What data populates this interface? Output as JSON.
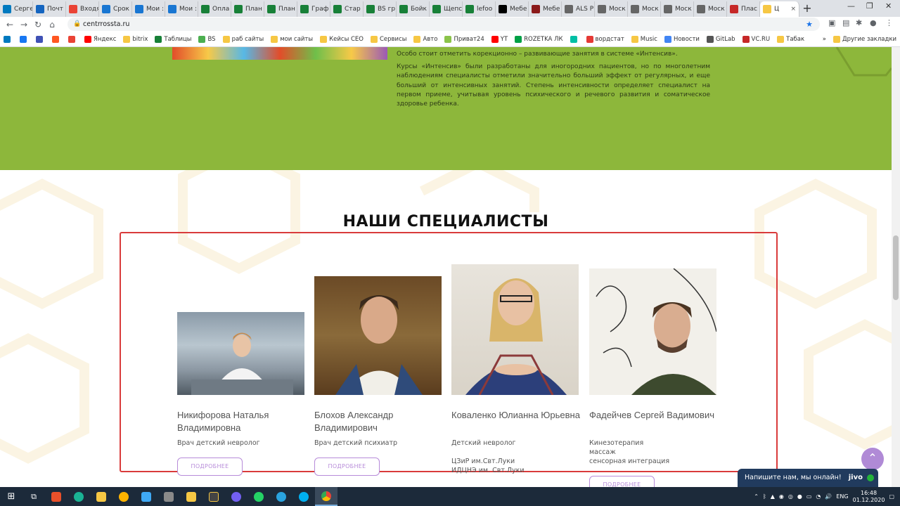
{
  "browser": {
    "tabs": [
      {
        "label": "Серге",
        "icon": "trello-icon",
        "color": "#0079bf"
      },
      {
        "label": "Почт",
        "icon": "mail-icon",
        "color": "#1565c0"
      },
      {
        "label": "Входя",
        "icon": "gmail-icon",
        "color": "#ea4335"
      },
      {
        "label": "Срок",
        "icon": "24-icon",
        "color": "#1976d2"
      },
      {
        "label": "Мои :",
        "icon": "24-icon",
        "color": "#1976d2"
      },
      {
        "label": "Мои :",
        "icon": "24-icon",
        "color": "#1976d2"
      },
      {
        "label": "Опла",
        "icon": "sheets-icon",
        "color": "#188038"
      },
      {
        "label": "План",
        "icon": "sheets-icon",
        "color": "#188038"
      },
      {
        "label": "План",
        "icon": "sheets-icon",
        "color": "#188038"
      },
      {
        "label": "Граф",
        "icon": "sheets-icon",
        "color": "#188038"
      },
      {
        "label": "Стар",
        "icon": "sheets-icon",
        "color": "#188038"
      },
      {
        "label": "BS гр",
        "icon": "sheets-icon",
        "color": "#188038"
      },
      {
        "label": "Бойк",
        "icon": "sheets-icon",
        "color": "#188038"
      },
      {
        "label": "Щепс",
        "icon": "sheets-icon",
        "color": "#188038"
      },
      {
        "label": "lefoo",
        "icon": "sheets-icon",
        "color": "#188038"
      },
      {
        "label": "Мебе",
        "icon": "site-icon",
        "color": "#000000"
      },
      {
        "label": "Мебе",
        "icon": "site-icon",
        "color": "#8b1a1a"
      },
      {
        "label": "ALS P",
        "icon": "globe-icon",
        "color": "#666666"
      },
      {
        "label": "Моск",
        "icon": "globe-icon",
        "color": "#666666"
      },
      {
        "label": "Моск",
        "icon": "globe-icon",
        "color": "#666666"
      },
      {
        "label": "Моск",
        "icon": "globe-icon",
        "color": "#666666"
      },
      {
        "label": "Моск",
        "icon": "globe-icon",
        "color": "#666666"
      },
      {
        "label": "Плас",
        "icon": "site-icon",
        "color": "#c62828"
      }
    ],
    "active_tab": {
      "label": "Ц",
      "icon": "site-icon"
    },
    "new_tab": "+",
    "url": "centrrossta.ru",
    "bookmarks_more": "»",
    "other_bookmarks": "Другие закладки",
    "bookmarks": [
      {
        "label": "",
        "color": "#0079bf"
      },
      {
        "label": "",
        "color": "#1877f2"
      },
      {
        "label": "",
        "color": "#3f51b5"
      },
      {
        "label": "",
        "color": "#ff5722"
      },
      {
        "label": "",
        "color": "#ea4335"
      },
      {
        "label": "Яндекс",
        "color": "#ff0000"
      },
      {
        "label": "bitrix",
        "color": "#f6c744"
      },
      {
        "label": "Таблицы",
        "color": "#188038"
      },
      {
        "label": "BS",
        "color": "#4caf50"
      },
      {
        "label": "раб сайты",
        "color": "#f6c744"
      },
      {
        "label": "мои сайты",
        "color": "#f6c744"
      },
      {
        "label": "Кейсы СЕО",
        "color": "#f6c744"
      },
      {
        "label": "Сервисы",
        "color": "#f6c744"
      },
      {
        "label": "Авто",
        "color": "#f6c744"
      },
      {
        "label": "Приват24",
        "color": "#8bc34a"
      },
      {
        "label": "YT",
        "color": "#ff0000"
      },
      {
        "label": "ROZETKA ЛК",
        "color": "#00a046"
      },
      {
        "label": "",
        "color": "#00bfa5"
      },
      {
        "label": "вордстат",
        "color": "#e53935"
      },
      {
        "label": "Music",
        "color": "#f6c744"
      },
      {
        "label": "Новости",
        "color": "#4285f4"
      },
      {
        "label": "GitLab",
        "color": "#555555"
      },
      {
        "label": "VC.RU",
        "color": "#c62828"
      },
      {
        "label": "Табак",
        "color": "#f6c744"
      }
    ]
  },
  "content": {
    "intro_paragraphs": [
      "Особо стоит отметить корекционно – развивающие занятия в системе «Интенсив».",
      "Курсы «Интенсив» были разработаны для иногородних пациентов, но по многолетним наблюдениям специалисты отметили значительно больший эффект от регулярных, и еще больший от интенсивных занятий. Степень интенсивности определяет специалист на первом приеме, учитывая уровень психического и речевого развития и соматическое здоровье ребенка."
    ],
    "section_title": "НАШИ СПЕЦИАЛИСТЫ",
    "specialists": [
      {
        "name": "Никифорова Наталья Владимировна",
        "role": "Врач детский невролог",
        "button": "ПОДРОБНЕЕ"
      },
      {
        "name": "Блохов Александр Владимирович",
        "role": "Врач детский психиатр",
        "button": "ПОДРОБНЕЕ"
      },
      {
        "name": "Коваленко Юлианна Юрьевна",
        "role": "Детский невролог",
        "extra": "ЦЗиР им.Свт.Луки\nИДЦНЭ им. Свт.Луки",
        "button": ""
      },
      {
        "name": "Фадейчев Сергей Вадимович",
        "role": "Кинезотерапия\nмассаж\nсенсорная интеграция",
        "button": "ПОДРОБНЕЕ"
      }
    ],
    "scroll_up": "^",
    "chat_text": "Напишите нам, мы онлайн!",
    "chat_brand": "jivo"
  },
  "taskbar": {
    "lang": "ENG",
    "time": "16:48",
    "date": "01.12.2020"
  },
  "colors": {
    "green_band": "#8db73b",
    "highlight_box": "#d93b3b",
    "button_border": "#b78bd9"
  }
}
